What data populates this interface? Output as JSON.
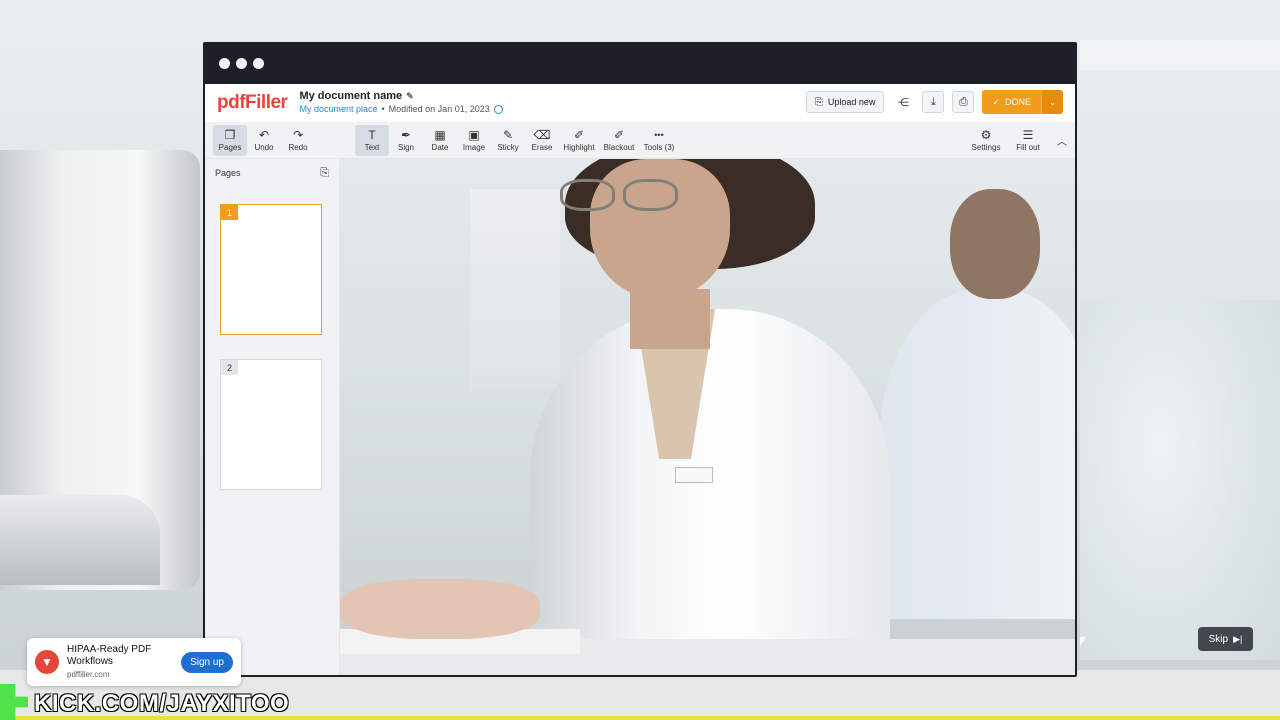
{
  "window": {
    "controls": [
      "close",
      "minimize",
      "maximize"
    ]
  },
  "header": {
    "logo": "pdfFiller",
    "doc_name": "My document name",
    "doc_place": "My document place",
    "modified": "Modified on Jan 01, 2023",
    "upload_label": "Upload new",
    "done_label": "DONE"
  },
  "toolbar": {
    "left": [
      {
        "label": "Pages",
        "icon": "pages-icon",
        "glyph": "❐"
      },
      {
        "label": "Undo",
        "icon": "undo-icon",
        "glyph": "↶"
      },
      {
        "label": "Redo",
        "icon": "redo-icon",
        "glyph": "↷"
      }
    ],
    "tools": [
      {
        "label": "Text",
        "icon": "text-icon",
        "glyph": "T"
      },
      {
        "label": "Sign",
        "icon": "sign-icon",
        "glyph": "✒"
      },
      {
        "label": "Date",
        "icon": "calendar-icon",
        "glyph": "▦"
      },
      {
        "label": "Image",
        "icon": "image-icon",
        "glyph": "▣"
      },
      {
        "label": "Sticky",
        "icon": "pin-icon",
        "glyph": "✎"
      },
      {
        "label": "Erase",
        "icon": "eraser-icon",
        "glyph": "⌫"
      },
      {
        "label": "Highlight",
        "icon": "highlighter-icon",
        "glyph": "✐"
      },
      {
        "label": "Blackout",
        "icon": "blackout-icon",
        "glyph": "✐"
      },
      {
        "label": "Tools (3)",
        "icon": "more-icon",
        "glyph": "•••"
      }
    ],
    "right": [
      {
        "label": "Settings",
        "icon": "gear-icon",
        "glyph": "⚙"
      },
      {
        "label": "Fill out",
        "icon": "list-icon",
        "glyph": "☰"
      }
    ]
  },
  "sidebar": {
    "title": "Pages",
    "pages": [
      "1",
      "2"
    ]
  },
  "ad": {
    "title": "HIPAA-Ready PDF Workflows",
    "url": "pdffiller.com",
    "cta": "Sign up"
  },
  "skip_label": "Skip",
  "watermark": "KICK.COM/JAYXITOO",
  "colors": {
    "brand": "#e5473b",
    "done": "#f39b1b",
    "cta": "#1f6fd1",
    "link": "#2c86c9"
  }
}
